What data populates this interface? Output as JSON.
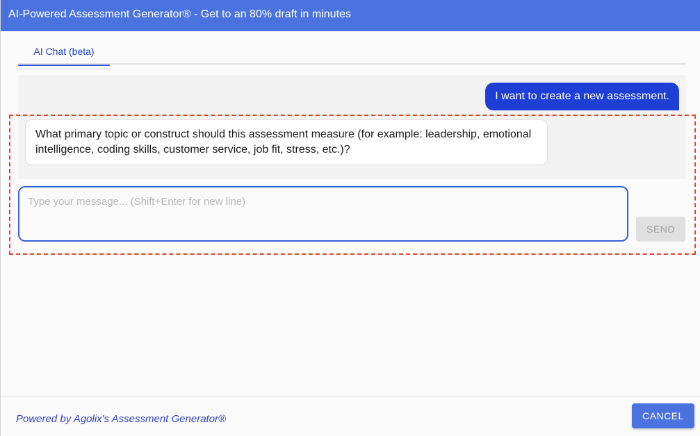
{
  "dialog": {
    "title": "AI-Powered Assessment Generator® - Get to an 80% draft in minutes"
  },
  "tabs": [
    {
      "label": "AI Chat (beta)",
      "active": true
    }
  ],
  "chat": {
    "messages": [
      {
        "role": "user",
        "text": "I want to create a new assessment."
      },
      {
        "role": "assistant",
        "text": "What primary topic or construct should this assessment measure (for example: leadership, emotional intelligence, coding skills, customer service, job fit, stress, etc.)?"
      }
    ]
  },
  "composer": {
    "placeholder": "Type your message... (Shift+Enter for new line)",
    "value": "",
    "send_label": "SEND"
  },
  "footer": {
    "powered_by": "Powered by Agolix's Assessment Generator®",
    "cancel_label": "CANCEL"
  },
  "colors": {
    "primary": "#4a73e0",
    "user_bubble": "#1d3fd6",
    "highlight": "#e8442f"
  }
}
